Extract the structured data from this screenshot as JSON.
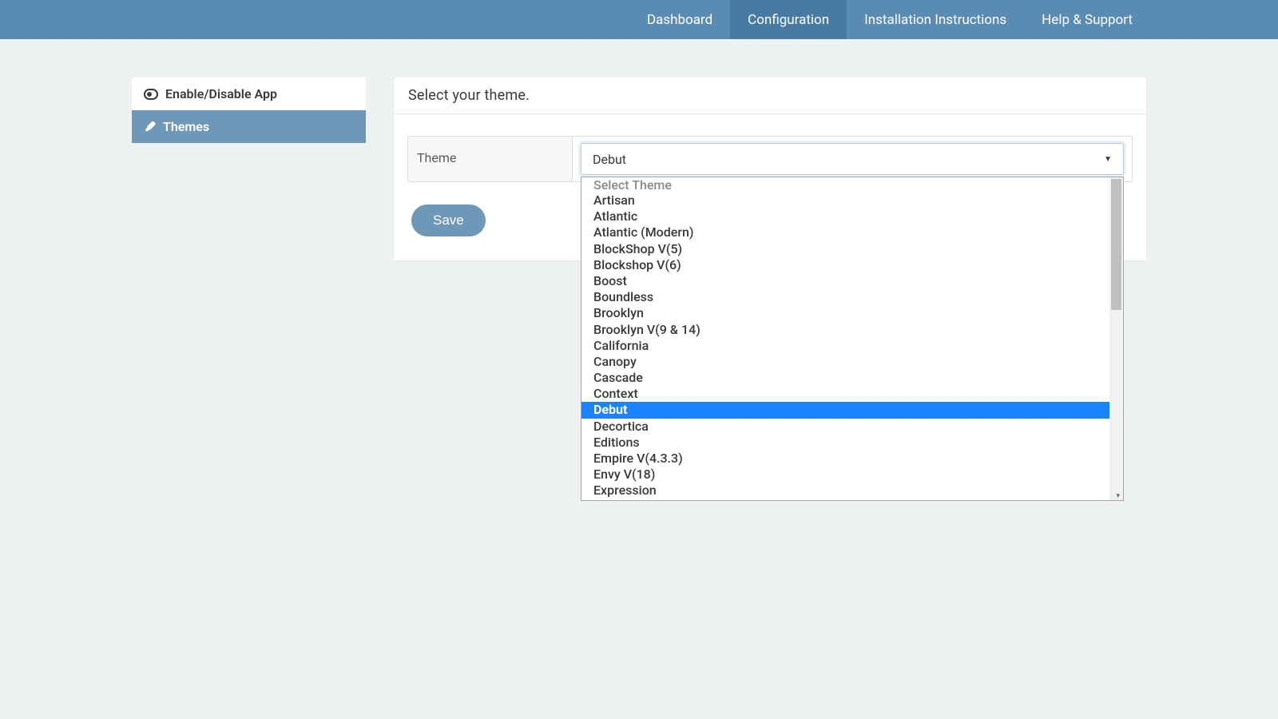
{
  "nav": {
    "items": [
      {
        "label": "Dashboard",
        "active": false
      },
      {
        "label": "Configuration",
        "active": true
      },
      {
        "label": "Installation Instructions",
        "active": false
      },
      {
        "label": "Help & Support",
        "active": false
      }
    ]
  },
  "sidebar": {
    "items": [
      {
        "label": "Enable/Disable App",
        "active": false
      },
      {
        "label": "Themes",
        "active": true
      }
    ]
  },
  "panel": {
    "title": "Select your theme.",
    "field_label": "Theme",
    "selected_value": "Debut",
    "save_label": "Save"
  },
  "dropdown": {
    "placeholder": "Select Theme",
    "options": [
      "Artisan",
      "Atlantic",
      "Atlantic (Modern)",
      "BlockShop V(5)",
      "Blockshop V(6)",
      "Boost",
      "Boundless",
      "Brooklyn",
      "Brooklyn V(9 & 14)",
      "California",
      "Canopy",
      "Cascade",
      "Context",
      "Debut",
      "Decortica",
      "Editions",
      "Empire V(4.3.3)",
      "Envy V(18)",
      "Expression"
    ],
    "selected_index": 13
  }
}
